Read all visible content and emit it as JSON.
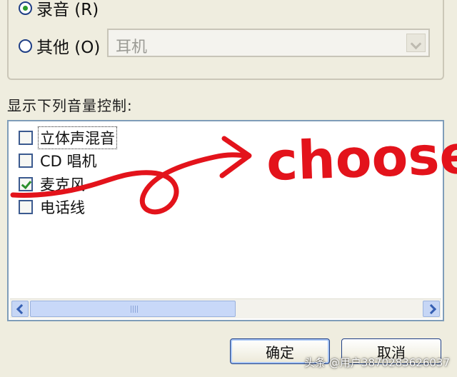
{
  "dialog": {
    "radio_record_label": "录音 (R)",
    "radio_other_label": "其他 (O)",
    "other_device_value": "耳机",
    "section_label": "显示下列音量控制:"
  },
  "list_items": [
    {
      "label": "立体声混音",
      "checked": false
    },
    {
      "label": "CD 唱机",
      "checked": false
    },
    {
      "label": "麦克风",
      "checked": true
    },
    {
      "label": "电话线",
      "checked": false
    }
  ],
  "buttons": {
    "ok": "确定",
    "cancel": "取消"
  },
  "annotation": {
    "text": "choose",
    "color": "#e3131b"
  },
  "watermark": "头条 @用户3870283626037",
  "colors": {
    "dialog_bg": "#efeddf",
    "list_bg": "#ffffff",
    "list_border": "#7f9db9",
    "annotation": "#e3131b",
    "checkbox_check": "#2c8f2c"
  }
}
